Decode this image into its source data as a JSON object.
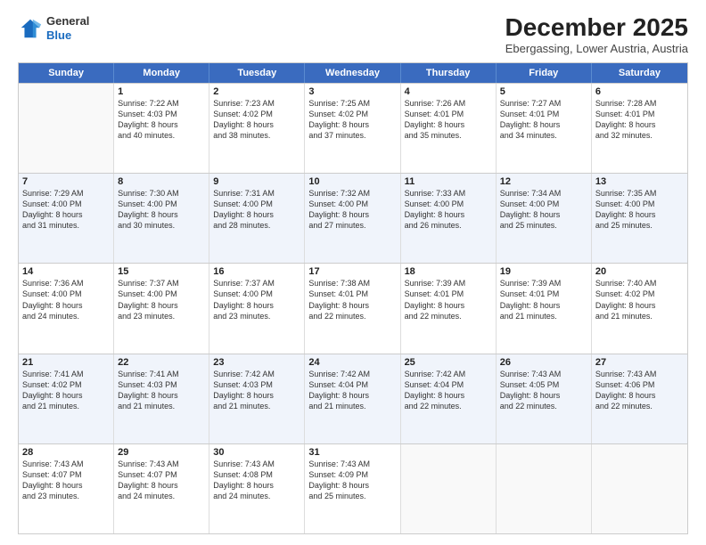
{
  "logo": {
    "general": "General",
    "blue": "Blue"
  },
  "title": "December 2025",
  "subtitle": "Ebergassing, Lower Austria, Austria",
  "weekdays": [
    "Sunday",
    "Monday",
    "Tuesday",
    "Wednesday",
    "Thursday",
    "Friday",
    "Saturday"
  ],
  "weeks": [
    [
      {
        "day": "",
        "info": ""
      },
      {
        "day": "1",
        "info": "Sunrise: 7:22 AM\nSunset: 4:03 PM\nDaylight: 8 hours\nand 40 minutes."
      },
      {
        "day": "2",
        "info": "Sunrise: 7:23 AM\nSunset: 4:02 PM\nDaylight: 8 hours\nand 38 minutes."
      },
      {
        "day": "3",
        "info": "Sunrise: 7:25 AM\nSunset: 4:02 PM\nDaylight: 8 hours\nand 37 minutes."
      },
      {
        "day": "4",
        "info": "Sunrise: 7:26 AM\nSunset: 4:01 PM\nDaylight: 8 hours\nand 35 minutes."
      },
      {
        "day": "5",
        "info": "Sunrise: 7:27 AM\nSunset: 4:01 PM\nDaylight: 8 hours\nand 34 minutes."
      },
      {
        "day": "6",
        "info": "Sunrise: 7:28 AM\nSunset: 4:01 PM\nDaylight: 8 hours\nand 32 minutes."
      }
    ],
    [
      {
        "day": "7",
        "info": "Sunrise: 7:29 AM\nSunset: 4:00 PM\nDaylight: 8 hours\nand 31 minutes."
      },
      {
        "day": "8",
        "info": "Sunrise: 7:30 AM\nSunset: 4:00 PM\nDaylight: 8 hours\nand 30 minutes."
      },
      {
        "day": "9",
        "info": "Sunrise: 7:31 AM\nSunset: 4:00 PM\nDaylight: 8 hours\nand 28 minutes."
      },
      {
        "day": "10",
        "info": "Sunrise: 7:32 AM\nSunset: 4:00 PM\nDaylight: 8 hours\nand 27 minutes."
      },
      {
        "day": "11",
        "info": "Sunrise: 7:33 AM\nSunset: 4:00 PM\nDaylight: 8 hours\nand 26 minutes."
      },
      {
        "day": "12",
        "info": "Sunrise: 7:34 AM\nSunset: 4:00 PM\nDaylight: 8 hours\nand 25 minutes."
      },
      {
        "day": "13",
        "info": "Sunrise: 7:35 AM\nSunset: 4:00 PM\nDaylight: 8 hours\nand 25 minutes."
      }
    ],
    [
      {
        "day": "14",
        "info": "Sunrise: 7:36 AM\nSunset: 4:00 PM\nDaylight: 8 hours\nand 24 minutes."
      },
      {
        "day": "15",
        "info": "Sunrise: 7:37 AM\nSunset: 4:00 PM\nDaylight: 8 hours\nand 23 minutes."
      },
      {
        "day": "16",
        "info": "Sunrise: 7:37 AM\nSunset: 4:00 PM\nDaylight: 8 hours\nand 23 minutes."
      },
      {
        "day": "17",
        "info": "Sunrise: 7:38 AM\nSunset: 4:01 PM\nDaylight: 8 hours\nand 22 minutes."
      },
      {
        "day": "18",
        "info": "Sunrise: 7:39 AM\nSunset: 4:01 PM\nDaylight: 8 hours\nand 22 minutes."
      },
      {
        "day": "19",
        "info": "Sunrise: 7:39 AM\nSunset: 4:01 PM\nDaylight: 8 hours\nand 21 minutes."
      },
      {
        "day": "20",
        "info": "Sunrise: 7:40 AM\nSunset: 4:02 PM\nDaylight: 8 hours\nand 21 minutes."
      }
    ],
    [
      {
        "day": "21",
        "info": "Sunrise: 7:41 AM\nSunset: 4:02 PM\nDaylight: 8 hours\nand 21 minutes."
      },
      {
        "day": "22",
        "info": "Sunrise: 7:41 AM\nSunset: 4:03 PM\nDaylight: 8 hours\nand 21 minutes."
      },
      {
        "day": "23",
        "info": "Sunrise: 7:42 AM\nSunset: 4:03 PM\nDaylight: 8 hours\nand 21 minutes."
      },
      {
        "day": "24",
        "info": "Sunrise: 7:42 AM\nSunset: 4:04 PM\nDaylight: 8 hours\nand 21 minutes."
      },
      {
        "day": "25",
        "info": "Sunrise: 7:42 AM\nSunset: 4:04 PM\nDaylight: 8 hours\nand 22 minutes."
      },
      {
        "day": "26",
        "info": "Sunrise: 7:43 AM\nSunset: 4:05 PM\nDaylight: 8 hours\nand 22 minutes."
      },
      {
        "day": "27",
        "info": "Sunrise: 7:43 AM\nSunset: 4:06 PM\nDaylight: 8 hours\nand 22 minutes."
      }
    ],
    [
      {
        "day": "28",
        "info": "Sunrise: 7:43 AM\nSunset: 4:07 PM\nDaylight: 8 hours\nand 23 minutes."
      },
      {
        "day": "29",
        "info": "Sunrise: 7:43 AM\nSunset: 4:07 PM\nDaylight: 8 hours\nand 24 minutes."
      },
      {
        "day": "30",
        "info": "Sunrise: 7:43 AM\nSunset: 4:08 PM\nDaylight: 8 hours\nand 24 minutes."
      },
      {
        "day": "31",
        "info": "Sunrise: 7:43 AM\nSunset: 4:09 PM\nDaylight: 8 hours\nand 25 minutes."
      },
      {
        "day": "",
        "info": ""
      },
      {
        "day": "",
        "info": ""
      },
      {
        "day": "",
        "info": ""
      }
    ]
  ]
}
